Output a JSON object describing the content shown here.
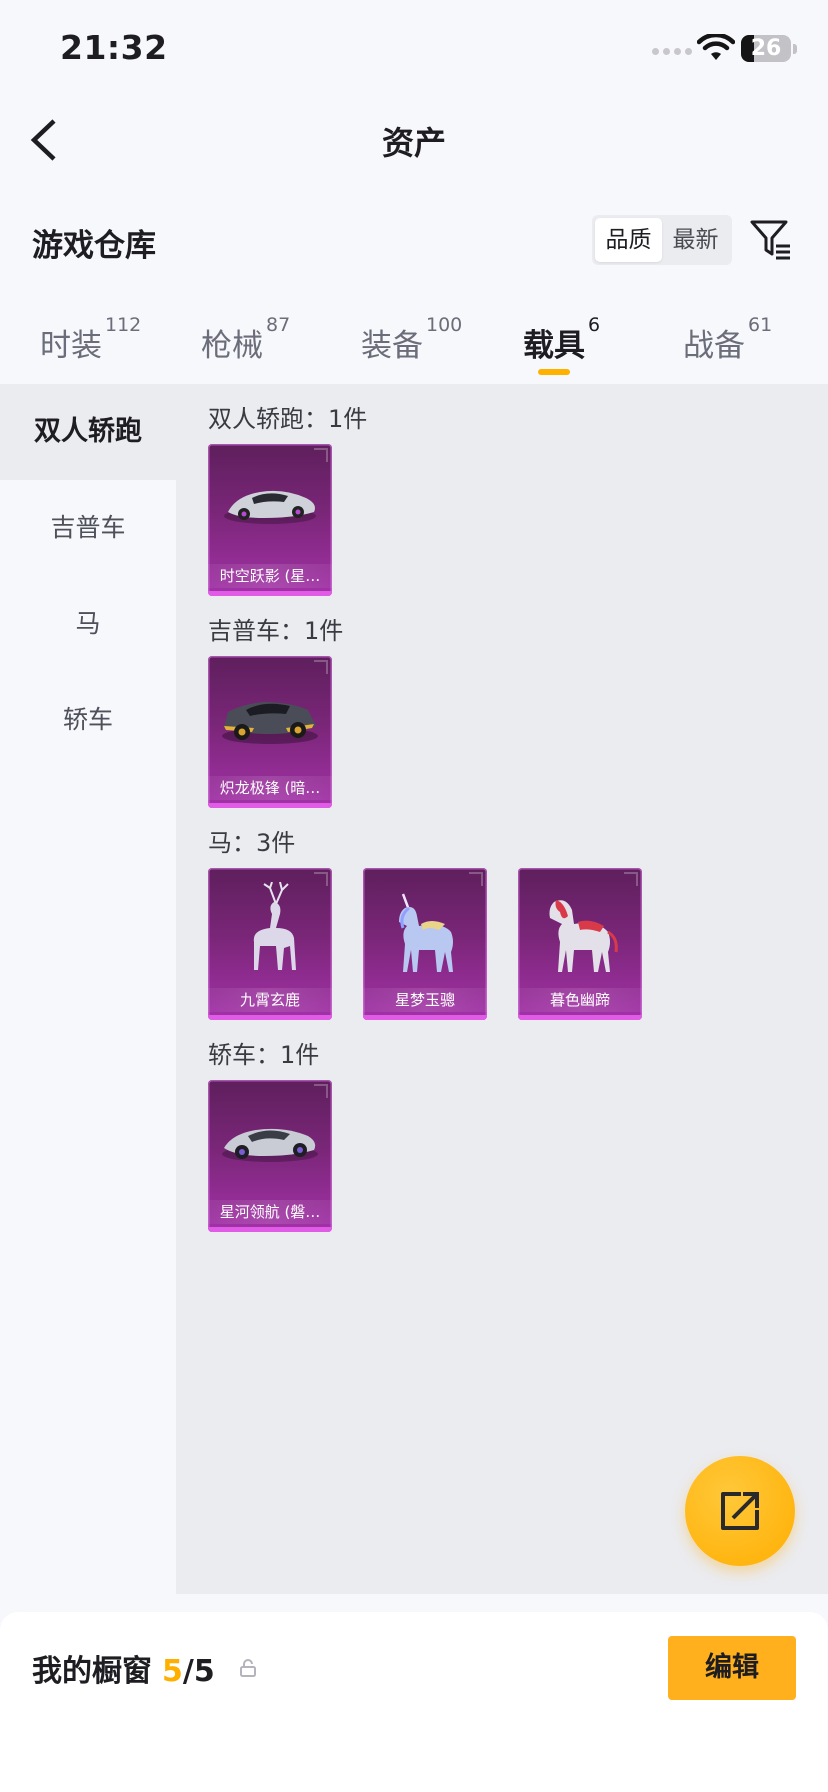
{
  "status_bar": {
    "time": "21:32",
    "battery": "26",
    "battery_level": 0.26,
    "icons": [
      "signal-dots-icon",
      "wifi-icon",
      "battery-icon"
    ]
  },
  "nav": {
    "title": "资产",
    "back_icon": "chevron-left-icon"
  },
  "warehouse": {
    "title": "游戏仓库",
    "sort_options": [
      "品质",
      "最新"
    ],
    "selected_sort": "品质",
    "filter_icon": "filter-funnel-icon"
  },
  "tabs": [
    {
      "label": "时装",
      "count": "112"
    },
    {
      "label": "枪械",
      "count": "87"
    },
    {
      "label": "装备",
      "count": "100"
    },
    {
      "label": "载具",
      "count": "6"
    },
    {
      "label": "战备",
      "count": "61"
    }
  ],
  "active_tab": "载具",
  "sidebar": {
    "items": [
      "双人轿跑",
      "吉普车",
      "马",
      "轿车"
    ],
    "active": "双人轿跑"
  },
  "sections": [
    {
      "title": "双人轿跑：1件",
      "items": [
        {
          "name": "时空跃影 (星…",
          "icon": "coupe-car-icon"
        }
      ]
    },
    {
      "title": "吉普车：1件",
      "items": [
        {
          "name": "炽龙极锋 (暗…",
          "icon": "jeep-car-icon"
        }
      ]
    },
    {
      "title": "马：3件",
      "items": [
        {
          "name": "九霄玄鹿",
          "icon": "deer-mount-icon"
        },
        {
          "name": "星梦玉骢",
          "icon": "unicorn-mount-icon"
        },
        {
          "name": "暮色幽蹄",
          "icon": "horse-mount-icon"
        }
      ]
    },
    {
      "title": "轿车：1件",
      "items": [
        {
          "name": "星河领航 (磐…",
          "icon": "sedan-car-icon"
        }
      ]
    }
  ],
  "colors": {
    "accent": "#ffb100",
    "card_purple": "#7a2678",
    "card_border": "#e05ce6"
  },
  "fab": {
    "icon": "share-out-icon"
  },
  "bottom": {
    "showcase_label": "我的橱窗",
    "showcase_current": "5",
    "showcase_total": "/5",
    "lock_icon": "lock-icon",
    "edit_label": "编辑"
  }
}
